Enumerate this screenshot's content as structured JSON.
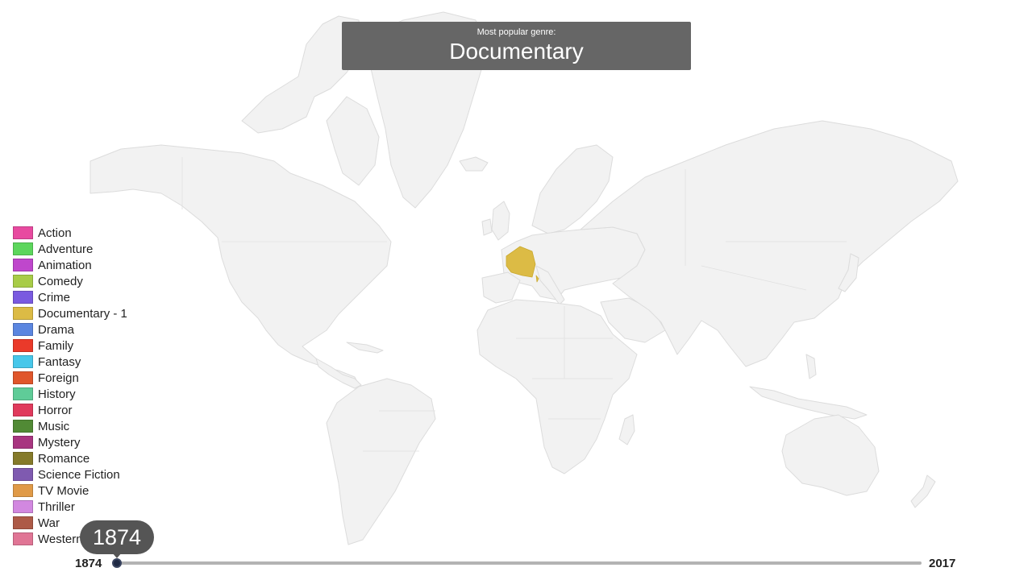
{
  "banner": {
    "caption": "Most popular genre:",
    "genre": "Documentary"
  },
  "map": {
    "highlighted_country": "France",
    "highlight_color": "#dcbb45",
    "land_color": "#f2f2f2"
  },
  "legend": [
    {
      "label": "Action",
      "color": "#e84aa0"
    },
    {
      "label": "Adventure",
      "color": "#5cd65c"
    },
    {
      "label": "Animation",
      "color": "#bf47cc"
    },
    {
      "label": "Comedy",
      "color": "#a8cc47"
    },
    {
      "label": "Crime",
      "color": "#7a5ae0"
    },
    {
      "label": "Documentary - 1",
      "color": "#dcbb45"
    },
    {
      "label": "Drama",
      "color": "#5b86e0"
    },
    {
      "label": "Family",
      "color": "#ea3a2a"
    },
    {
      "label": "Fantasy",
      "color": "#47c7ea"
    },
    {
      "label": "Foreign",
      "color": "#e0562b"
    },
    {
      "label": "History",
      "color": "#5fcc98"
    },
    {
      "label": "Horror",
      "color": "#e03a5c"
    },
    {
      "label": "Music",
      "color": "#518a35"
    },
    {
      "label": "Mystery",
      "color": "#a83580"
    },
    {
      "label": "Romance",
      "color": "#857a2a"
    },
    {
      "label": "Science Fiction",
      "color": "#7f5ab0"
    },
    {
      "label": "TV Movie",
      "color": "#e09a47"
    },
    {
      "label": "Thriller",
      "color": "#d288e0"
    },
    {
      "label": "War",
      "color": "#ad5a47"
    },
    {
      "label": "Western",
      "color": "#e07595"
    }
  ],
  "timeline": {
    "min_label": "1874",
    "max_label": "2017",
    "current": "1874"
  }
}
